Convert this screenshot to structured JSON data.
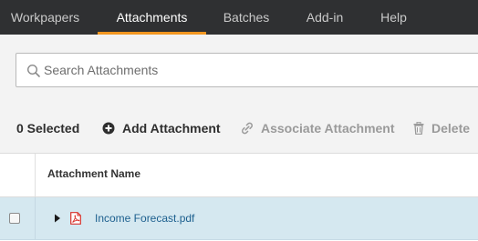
{
  "nav": {
    "tabs": [
      {
        "label": "Workpapers",
        "active": false
      },
      {
        "label": "Attachments",
        "active": true
      },
      {
        "label": "Batches",
        "active": false
      },
      {
        "label": "Add-in",
        "active": false
      },
      {
        "label": "Help",
        "active": false
      }
    ],
    "accent_color": "#f29620",
    "background_color": "#2f3032"
  },
  "search": {
    "placeholder": "Search Attachments",
    "value": "",
    "icon": "search-icon"
  },
  "toolbar": {
    "selected_label": "0 Selected",
    "add_label": "Add Attachment",
    "add_icon": "plus-circle-icon",
    "associate_label": "Associate Attachment",
    "associate_icon": "link-icon",
    "delete_label": "Delete",
    "delete_icon": "trash-icon"
  },
  "table": {
    "columns": [
      "Attachment Name"
    ],
    "rows": [
      {
        "name": "Income Forecast.pdf",
        "type_icon": "pdf-icon",
        "selected": false,
        "expanded": false,
        "highlight_color": "#d5e8f0"
      }
    ]
  }
}
